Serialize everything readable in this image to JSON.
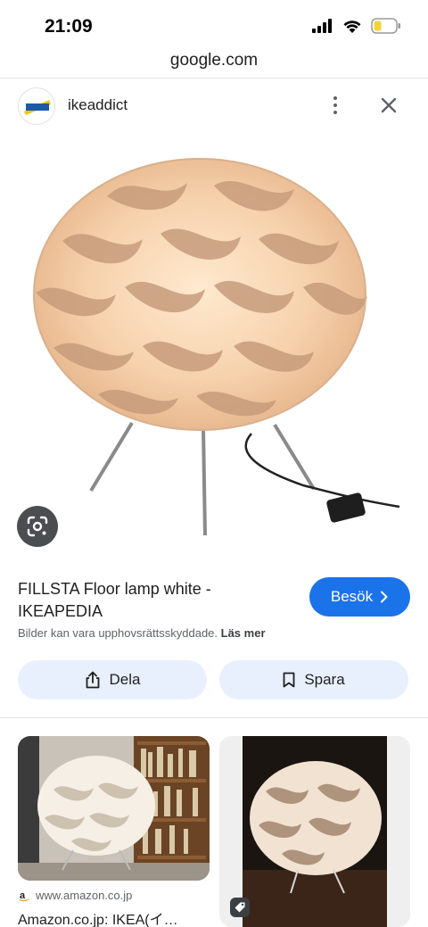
{
  "status_bar": {
    "time": "21:09"
  },
  "browser": {
    "url": "google.com"
  },
  "site": {
    "name": "ikeaddict",
    "logo_text": "IKEADDICT"
  },
  "result": {
    "title": "FILLSTA Floor lamp white - IKEAPEDIA",
    "visit_label": "Besök",
    "copyright_text": "Bilder kan vara upphovsrättsskyddade.",
    "read_more": "Läs mer",
    "share_label": "Dela",
    "save_label": "Spara"
  },
  "related": [
    {
      "source": "www.amazon.co.jp",
      "title": "Amazon.co.jp: IKEA(イ…"
    }
  ],
  "icons": {
    "signal": "signal-icon",
    "wifi": "wifi-icon",
    "battery": "battery-icon",
    "more": "more-vert-icon",
    "close": "close-icon",
    "lens": "google-lens-icon",
    "share": "share-icon",
    "bookmark": "bookmark-icon",
    "chevron": "chevron-right-icon",
    "amazon": "amazon-icon",
    "tag": "tag-icon"
  },
  "colors": {
    "accent": "#1a73e8",
    "button_bg": "#e8f0fe",
    "battery": "#f3d33a"
  }
}
